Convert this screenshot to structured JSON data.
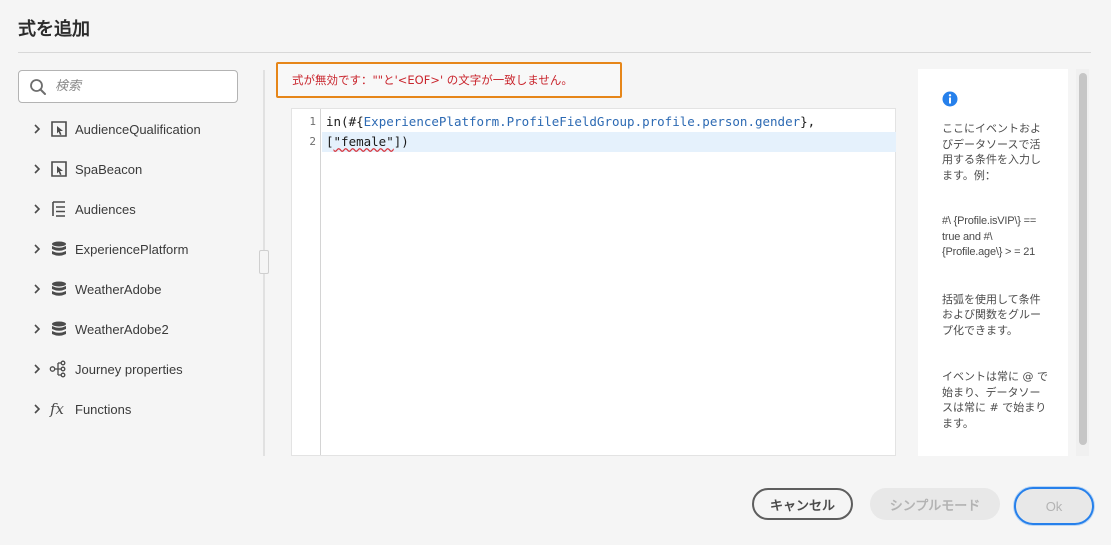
{
  "dialog": {
    "title": "式を追加"
  },
  "search": {
    "placeholder": "検索"
  },
  "tree": [
    {
      "label": "AudienceQualification",
      "icon": "audience-qualification-icon"
    },
    {
      "label": "SpaBeacon",
      "icon": "event-icon"
    },
    {
      "label": "Audiences",
      "icon": "hierarchy-icon"
    },
    {
      "label": "ExperiencePlatform",
      "icon": "database-icon"
    },
    {
      "label": "WeatherAdobe",
      "icon": "database-icon"
    },
    {
      "label": "WeatherAdobe2",
      "icon": "database-icon"
    },
    {
      "label": "Journey properties",
      "icon": "journey-properties-icon"
    },
    {
      "label": "Functions",
      "icon": "function-icon"
    }
  ],
  "error": {
    "message": "式が無効です：\"\"と'<EOF>' の文字が一致しません。"
  },
  "editor": {
    "lines": [
      {
        "number": "1",
        "prefix": "in(#{",
        "ident": "ExperiencePlatform.ProfileFieldGroup.profile.person.gender",
        "suffix": "},"
      },
      {
        "number": "2",
        "prefix": "[",
        "string": "\"female\"",
        "suffix": "])"
      }
    ],
    "active_line": 2
  },
  "help": {
    "paragraphs": [
      "ここにイベントおよびデータソースで活用する条件を入力します。例：",
      "#\\ {Profile.isVIP\\} == true and #\\ {Profile.age\\} > = 21",
      "括弧を使用して条件および関数をグループ化できます。",
      "イベントは常に @ で始まり、データソースは常に # で始まります。"
    ]
  },
  "buttons": {
    "cancel": "キャンセル",
    "simple_mode": "シンプルモード",
    "ok": "Ok"
  },
  "colors": {
    "error": "#c9252d",
    "error_border": "#e68619",
    "accent": "#2680eb",
    "info_icon": "#2680eb"
  }
}
